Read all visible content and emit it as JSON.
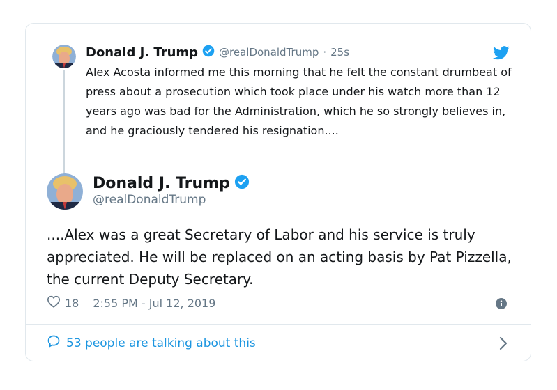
{
  "parent_tweet": {
    "name": "Donald J. Trump",
    "handle": "@realDonaldTrump",
    "separator": "·",
    "time": "25s",
    "text": "Alex Acosta informed me this morning that he felt the constant drumbeat of press about a prosecution which took place under his watch more than 12 years ago was bad for the Administration, which he so strongly believes in, and he graciously tendered his resignation...."
  },
  "main_tweet": {
    "name": "Donald J. Trump",
    "handle": "@realDonaldTrump",
    "text": "....Alex was a great Secretary of Labor and his service is truly appreciated. He will be replaced on an acting basis by Pat Pizzella, the current Deputy Secretary.",
    "likes": "18",
    "timestamp": "2:55 PM - Jul 12, 2019"
  },
  "footer": {
    "talking_label": "53 people are talking about this"
  },
  "icons": {
    "verified": "verified-badge-icon",
    "bird": "twitter-bird-icon",
    "heart": "heart-icon",
    "info": "info-icon",
    "comment": "comment-bubble-icon",
    "chevron": "chevron-right-icon"
  },
  "colors": {
    "accent": "#1da1f2",
    "link": "#1b95e0",
    "secondary_text": "#657786",
    "border": "#e1e8ed"
  }
}
